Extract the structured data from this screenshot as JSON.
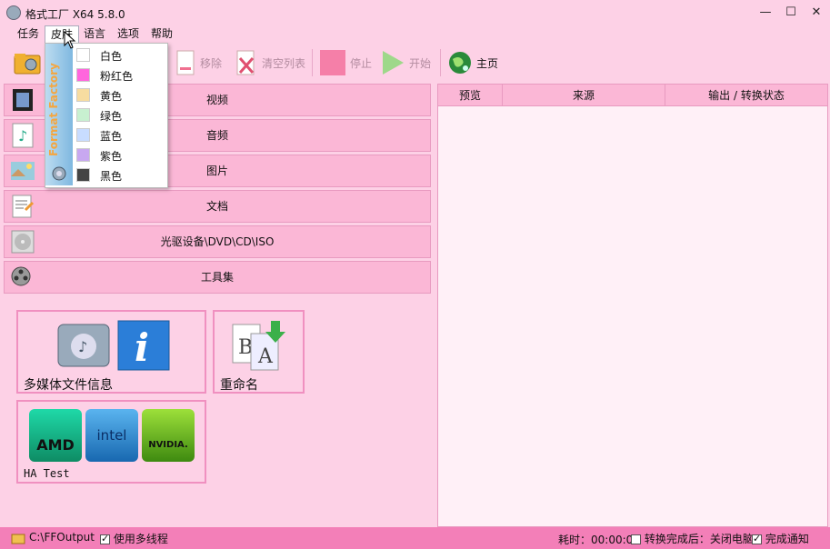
{
  "window": {
    "title": "格式工厂 X64 5.8.0"
  },
  "menu": {
    "items": [
      "任务",
      "皮肤",
      "语言",
      "选项",
      "帮助"
    ]
  },
  "toolbar": {
    "remove": "移除",
    "clear": "清空列表",
    "stop": "停止",
    "start": "开始",
    "home": "主页"
  },
  "categories": [
    "视频",
    "音频",
    "图片",
    "文档",
    "光驱设备\\DVD\\CD\\ISO",
    "工具集"
  ],
  "tools": {
    "media_info": "多媒体文件信息",
    "rename": "重命名",
    "ha_test": "HA Test",
    "amd_logo": "AMD",
    "intel_logo": "intel",
    "nvidia_logo": "NVIDIA."
  },
  "table": {
    "columns": [
      "预览",
      "来源",
      "输出 / 转换状态"
    ]
  },
  "statusbar": {
    "output_path": "C:\\FFOutput",
    "multithread": "使用多线程",
    "elapsed": "耗时：00:00:00",
    "shutdown": "转换完成后：关闭电脑",
    "notify": "完成通知"
  },
  "skin_menu": {
    "brand": "Format Factory",
    "items": [
      {
        "label": "白色",
        "color": "#ffffff"
      },
      {
        "label": "粉红色",
        "color": "#ff66dd"
      },
      {
        "label": "黄色",
        "color": "#f7dca0"
      },
      {
        "label": "绿色",
        "color": "#c8f0d0"
      },
      {
        "label": "蓝色",
        "color": "#c8dcff"
      },
      {
        "label": "紫色",
        "color": "#c8a8f0"
      },
      {
        "label": "黑色",
        "color": "#444444"
      }
    ]
  }
}
